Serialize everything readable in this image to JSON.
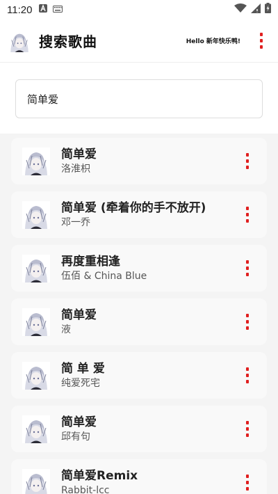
{
  "status_bar": {
    "time": "11:20",
    "icons": [
      "a-box-icon",
      "keyboard-icon",
      "wifi-icon",
      "signal-icon",
      "battery-icon"
    ]
  },
  "header": {
    "title": "搜索歌曲",
    "greeting": "Hello 新年快乐鸭!",
    "menu_icon": "more-vert-icon",
    "accent_color": "#e02020"
  },
  "search": {
    "value": "简单爱"
  },
  "songs": [
    {
      "title": "简单爱",
      "artist": "洛淮枳"
    },
    {
      "title": "简单爱 (牵着你的手不放开)",
      "artist": "邓一乔"
    },
    {
      "title": "再度重相逢",
      "artist": "伍佰 & China Blue"
    },
    {
      "title": "简单爱",
      "artist": "液"
    },
    {
      "title": "简 单 爱",
      "artist": "纯爱死宅"
    },
    {
      "title": "简单爱",
      "artist": "邱有句"
    },
    {
      "title": "简单爱Remix",
      "artist": "Rabbit-lcc"
    }
  ]
}
